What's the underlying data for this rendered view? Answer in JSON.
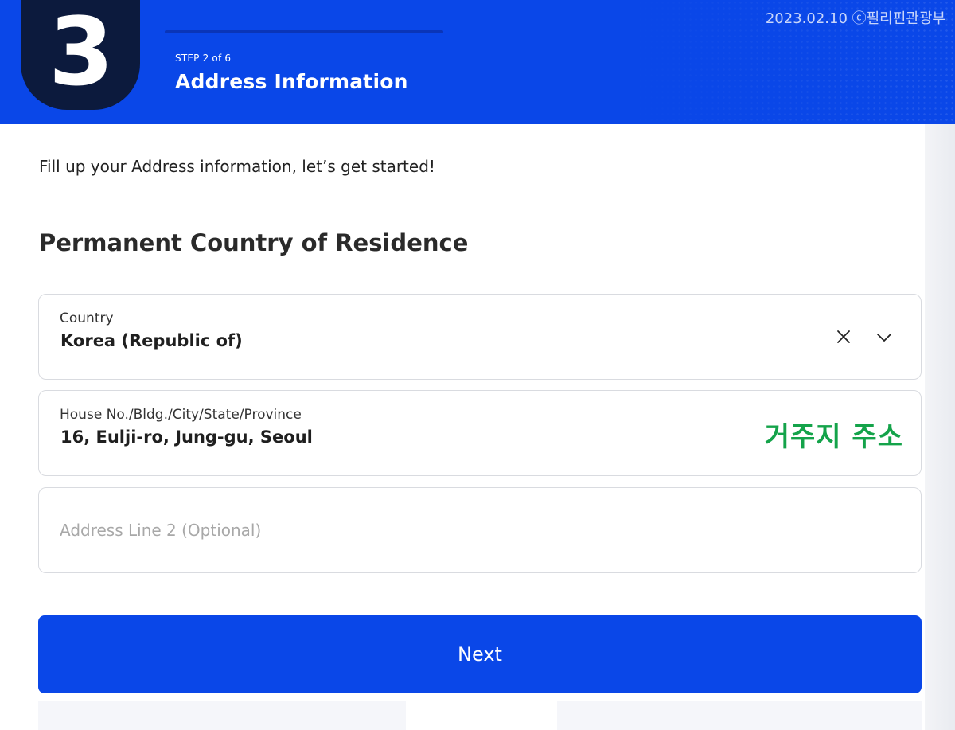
{
  "header": {
    "step_number": "3",
    "step_label": "STEP 2 of 6",
    "title": "Address Information",
    "watermark": "2023.02.10 ⓒ필리핀관광부",
    "colors": {
      "banner": "#0a47e8",
      "badge": "#0c1a3d"
    }
  },
  "main": {
    "intro": "Fill up your Address information, let’s get started!",
    "section_title": "Permanent Country of Residence",
    "fields": {
      "country": {
        "label": "Country",
        "value": "Korea (Republic of)",
        "icons": [
          "close-icon",
          "chevron-down-icon"
        ]
      },
      "address1": {
        "label": "House No./Bldg./City/State/Province",
        "value": "16, Eulji-ro, Jung-gu, Seoul",
        "annotation": "거주지 주소",
        "annotation_color": "#14a34a"
      },
      "address2": {
        "placeholder": "Address Line 2 (Optional)",
        "value": ""
      }
    },
    "next_button": {
      "label": "Next",
      "color": "#0a47e8"
    }
  }
}
